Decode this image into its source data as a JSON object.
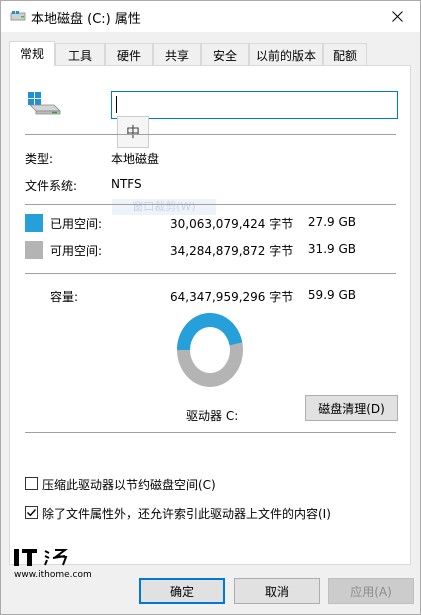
{
  "window": {
    "title": "本地磁盘 (C:) 属性"
  },
  "tabs": [
    {
      "label": "常规",
      "active": true
    },
    {
      "label": "工具"
    },
    {
      "label": "硬件"
    },
    {
      "label": "共享"
    },
    {
      "label": "安全"
    },
    {
      "label": "以前的版本"
    },
    {
      "label": "配额"
    }
  ],
  "general": {
    "name_value": "",
    "ime_indicator": "中",
    "ghost_button": "窗口裁剪(W)",
    "type_label": "类型:",
    "type_value": "本地磁盘",
    "fs_label": "文件系统:",
    "fs_value": "NTFS",
    "used_label": "已用空间:",
    "used_bytes": "30,063,079,424 字节",
    "used_gb": "27.9 GB",
    "free_label": "可用空间:",
    "free_bytes": "34,284,879,872 字节",
    "free_gb": "31.9 GB",
    "capacity_label": "容量:",
    "capacity_bytes": "64,347,959,296 字节",
    "capacity_gb": "59.9 GB",
    "drive_label": "驱动器 C:",
    "cleanup_button": "磁盘清理(D)",
    "compress_label": "压缩此驱动器以节约磁盘空间(C)",
    "compress_checked": false,
    "index_label": "除了文件属性外，还允许索引此驱动器上文件的内容(I)",
    "index_checked": true
  },
  "usage": {
    "used_fraction": 0.467,
    "used_color": "#26a0da",
    "free_color": "#b4b4b4"
  },
  "footer": {
    "ok": "确定",
    "cancel": "取消",
    "apply": "应用(A)"
  },
  "watermark": {
    "site": "www.ithome.com"
  },
  "colors": {
    "accent": "#0078d7"
  }
}
